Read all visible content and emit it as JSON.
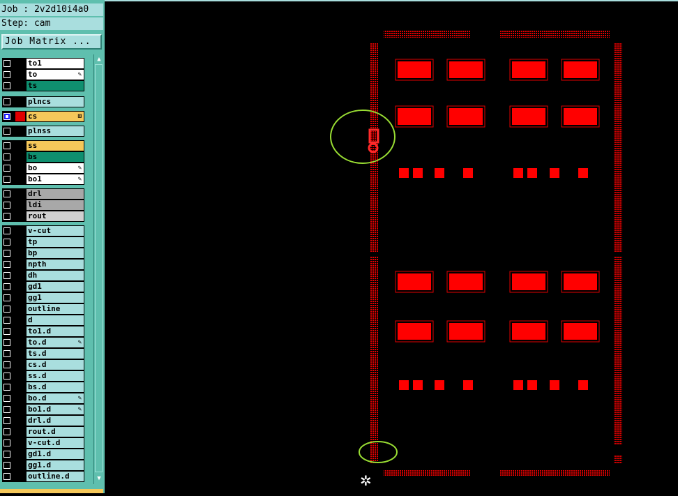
{
  "header": {
    "job_label": "Job : 2v2d10i4a0",
    "step_label": "Step: cam"
  },
  "job_matrix_button": "Job Matrix ...",
  "colors": {
    "sidebar_bg": "#5fbfae",
    "feature": "#ff0000",
    "highlight": "#99dd33",
    "canvas_bg": "#000000"
  },
  "layers": [
    {
      "name": "to1",
      "bg": "#ffffff",
      "mark": ""
    },
    {
      "name": "to",
      "bg": "#ffffff",
      "mark": "✎"
    },
    {
      "name": "ts",
      "bg": "#0f8f6f",
      "mark": ""
    },
    {
      "name": "plncs",
      "bg": "#a9dede",
      "mark": ""
    },
    {
      "name": "cs",
      "bg": "#f5c85a",
      "mark": "⊞",
      "selected": true
    },
    {
      "name": "plnss",
      "bg": "#a9dede",
      "mark": ""
    },
    {
      "name": "ss",
      "bg": "#f5c85a",
      "mark": ""
    },
    {
      "name": "bs",
      "bg": "#0f8f6f",
      "mark": ""
    },
    {
      "name": "bo",
      "bg": "#ffffff",
      "mark": "✎"
    },
    {
      "name": "bo1",
      "bg": "#ffffff",
      "mark": "✎"
    },
    {
      "name": "drl",
      "bg": "#a8a8a8",
      "mark": ""
    },
    {
      "name": "ldi",
      "bg": "#a8a8a8",
      "mark": ""
    },
    {
      "name": "rout",
      "bg": "#d0d0d0",
      "mark": ""
    },
    {
      "name": "v-cut",
      "bg": "#a9dede",
      "mark": ""
    },
    {
      "name": "tp",
      "bg": "#a9dede",
      "mark": ""
    },
    {
      "name": "bp",
      "bg": "#a9dede",
      "mark": ""
    },
    {
      "name": "npth",
      "bg": "#a9dede",
      "mark": ""
    },
    {
      "name": "dh",
      "bg": "#a9dede",
      "mark": ""
    },
    {
      "name": "gd1",
      "bg": "#a9dede",
      "mark": ""
    },
    {
      "name": "gg1",
      "bg": "#a9dede",
      "mark": ""
    },
    {
      "name": "outline",
      "bg": "#a9dede",
      "mark": ""
    },
    {
      "name": "d",
      "bg": "#a9dede",
      "mark": ""
    },
    {
      "name": "to1.d",
      "bg": "#a9dede",
      "mark": ""
    },
    {
      "name": "to.d",
      "bg": "#a9dede",
      "mark": "✎"
    },
    {
      "name": "ts.d",
      "bg": "#a9dede",
      "mark": ""
    },
    {
      "name": "cs.d",
      "bg": "#a9dede",
      "mark": ""
    },
    {
      "name": "ss.d",
      "bg": "#a9dede",
      "mark": ""
    },
    {
      "name": "bs.d",
      "bg": "#a9dede",
      "mark": ""
    },
    {
      "name": "bo.d",
      "bg": "#a9dede",
      "mark": "✎"
    },
    {
      "name": "bo1.d",
      "bg": "#a9dede",
      "mark": "✎"
    },
    {
      "name": "drl.d",
      "bg": "#a9dede",
      "mark": ""
    },
    {
      "name": "rout.d",
      "bg": "#a9dede",
      "mark": ""
    },
    {
      "name": "v-cut.d",
      "bg": "#a9dede",
      "mark": ""
    },
    {
      "name": "gd1.d",
      "bg": "#a9dede",
      "mark": ""
    },
    {
      "name": "gg1.d",
      "bg": "#a9dede",
      "mark": ""
    },
    {
      "name": "outline.d",
      "bg": "#a9dede",
      "mark": ""
    }
  ],
  "scroll": {
    "up": "▲",
    "down": "▼"
  },
  "crosshair_icon": "✲"
}
